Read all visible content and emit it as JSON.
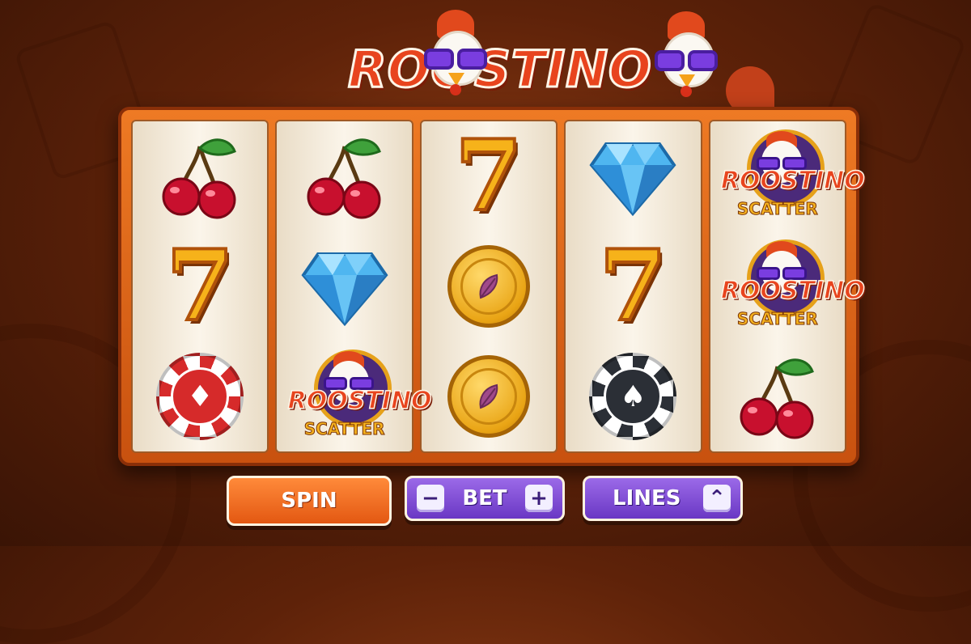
{
  "logo": {
    "text": "ROOSTINO"
  },
  "reels": [
    [
      "cherry",
      "seven",
      "chip-red"
    ],
    [
      "cherry",
      "diamond",
      "scatter"
    ],
    [
      "seven",
      "coin",
      "coin"
    ],
    [
      "diamond",
      "seven",
      "chip-black"
    ],
    [
      "scatter",
      "scatter",
      "cherry"
    ]
  ],
  "symbols": {
    "seven": {
      "glyph": "7"
    },
    "chip_red": {
      "glyph": "♦"
    },
    "chip_black": {
      "glyph": "♠"
    },
    "scatter": {
      "title": "ROOSTINO",
      "subtitle": "SCATTER"
    }
  },
  "controls": {
    "spin_label": "SPIN",
    "bet_label": "BET",
    "bet_minus": "−",
    "bet_plus": "+",
    "lines_label": "LINES",
    "lines_toggle": "⌃"
  },
  "colors": {
    "background": "#5e2209",
    "frame": "#ee7a24",
    "spin_button": "#e35812",
    "purple_button": "#7a45d6",
    "logo_red": "#e8441e"
  }
}
